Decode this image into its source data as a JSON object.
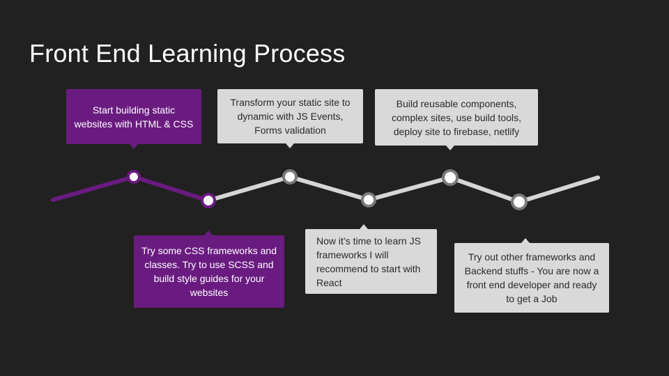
{
  "slide": {
    "title": "Front End Learning Process"
  },
  "colors": {
    "background": "#212121",
    "accent_purple": "#6a1b80",
    "line_gray": "#d6d6d6",
    "node_ring_gray": "#7a7a7a",
    "callout_gray": "#d9d9d9"
  },
  "steps": [
    {
      "id": "html-css",
      "text": "Start building static websites with HTML & CSS",
      "style": "purple"
    },
    {
      "id": "css-frameworks",
      "text": "Try some CSS frameworks and classes. Try to use SCSS and build style guides for your websites",
      "style": "purple"
    },
    {
      "id": "js-events",
      "text": "Transform your static site to dynamic with JS Events, Forms validation",
      "style": "gray"
    },
    {
      "id": "js-frameworks",
      "text": "Now it’s time to learn JS frameworks I will recommend to start with React",
      "style": "gray"
    },
    {
      "id": "build-tools",
      "text": "Build reusable components, complex sites, use build tools, deploy site to firebase, netlify",
      "style": "gray"
    },
    {
      "id": "backend",
      "text": "Try out other frameworks and Backend stuffs - You are now a front end developer and ready to get a Job",
      "style": "gray"
    }
  ]
}
